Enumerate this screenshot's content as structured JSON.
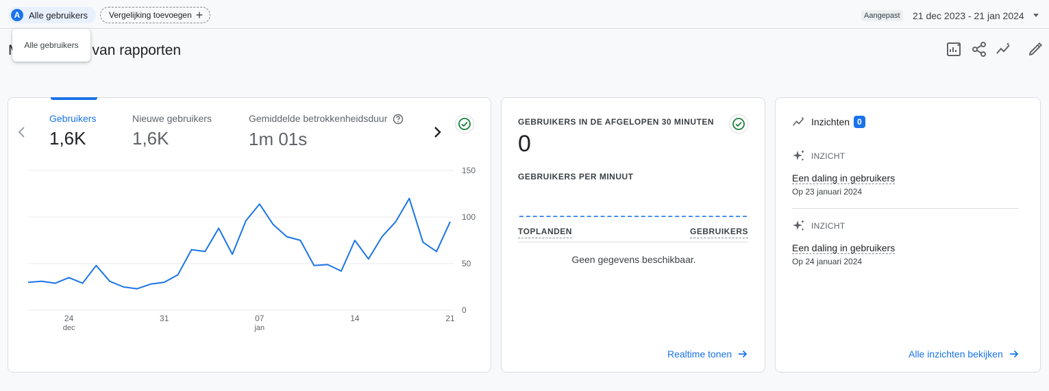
{
  "topbar": {
    "segment_avatar": "A",
    "segment_label": "Alle gebruikers",
    "compare_label": "Vergelijking toevoegen",
    "date_tag": "Aangepast",
    "date_range": "21 dec 2023 - 21 jan 2024"
  },
  "tooltip": {
    "text": "Alle gebruikers"
  },
  "page": {
    "title": "M          ame van rapporten"
  },
  "actions": [
    "customize-report-icon",
    "share-icon",
    "insights-icon",
    "edit-icon"
  ],
  "main_card": {
    "metrics": [
      {
        "label": "Gebruikers",
        "value": "1,6K",
        "active": true
      },
      {
        "label": "Nieuwe gebruikers",
        "value": "1,6K",
        "active": false
      },
      {
        "label": "Gemiddelde betrokkenheidsduur",
        "value": "1m 01s",
        "active": false
      }
    ]
  },
  "chart_data": {
    "type": "line",
    "series_color": "#1a73e8",
    "x_ticks": [
      {
        "day": "24",
        "month": "dec",
        "index": 3
      },
      {
        "day": "31",
        "month": "",
        "index": 10
      },
      {
        "day": "07",
        "month": "jan",
        "index": 17
      },
      {
        "day": "14",
        "month": "",
        "index": 24
      },
      {
        "day": "21",
        "month": "",
        "index": 31
      }
    ],
    "ylim": [
      0,
      150
    ],
    "y_ticks": [
      "150",
      "100",
      "50",
      "0"
    ],
    "grid": true,
    "values": [
      30,
      31,
      29,
      35,
      29,
      48,
      31,
      25,
      23,
      28,
      30,
      38,
      65,
      63,
      88,
      60,
      96,
      114,
      92,
      79,
      75,
      48,
      49,
      42,
      75,
      55,
      79,
      95,
      120,
      73,
      63,
      95
    ]
  },
  "realtime_card": {
    "title": "GEBRUIKERS IN DE AFGELOPEN 30 MINUTEN",
    "value": "0",
    "per_minute_label": "GEBRUIKERS PER MINUUT",
    "col_left": "TOPLANDEN",
    "col_right": "GEBRUIKERS",
    "empty_text": "Geen gegevens beschikbaar.",
    "link": "Realtime tonen"
  },
  "insights_card": {
    "title": "Inzichten",
    "count": "0",
    "items": [
      {
        "tag": "INZICHT",
        "headline": "Een daling in gebruikers",
        "date": "Op 23 januari 2024"
      },
      {
        "tag": "INZICHT",
        "headline": "Een daling in gebruikers",
        "date": "Op 24 januari 2024"
      }
    ],
    "link": "Alle inzichten bekijken"
  }
}
